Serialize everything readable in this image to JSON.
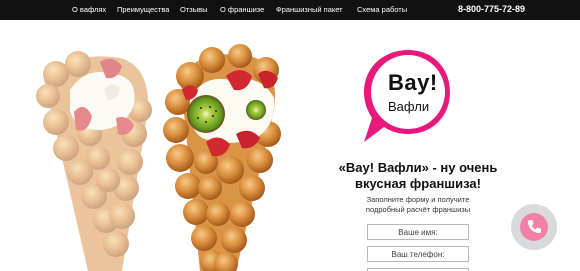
{
  "nav": {
    "items": [
      {
        "label": "О вафлях"
      },
      {
        "label": "Преимущества"
      },
      {
        "label": "Отзывы"
      },
      {
        "label": "О франшизе"
      },
      {
        "label": "Франшизный пакет"
      },
      {
        "label": "Схема работы"
      }
    ],
    "phone": "8-800-775-72-89"
  },
  "logo": {
    "line1": "Вау!",
    "line2": "Вафли",
    "accent_color": "#e8197d"
  },
  "hero": {
    "headline_line1": "«Вау! Вафли» - ну очень",
    "headline_line2": "вкусная франшиза!",
    "subline_line1": "Заполните форму и получите",
    "subline_line2": "подробный расчёт франшизы"
  },
  "form": {
    "name_placeholder": "Ваше имя:",
    "phone_placeholder": "Ваш телефон:"
  },
  "call_button": {
    "icon": "phone-icon",
    "color": "#f081a7"
  }
}
